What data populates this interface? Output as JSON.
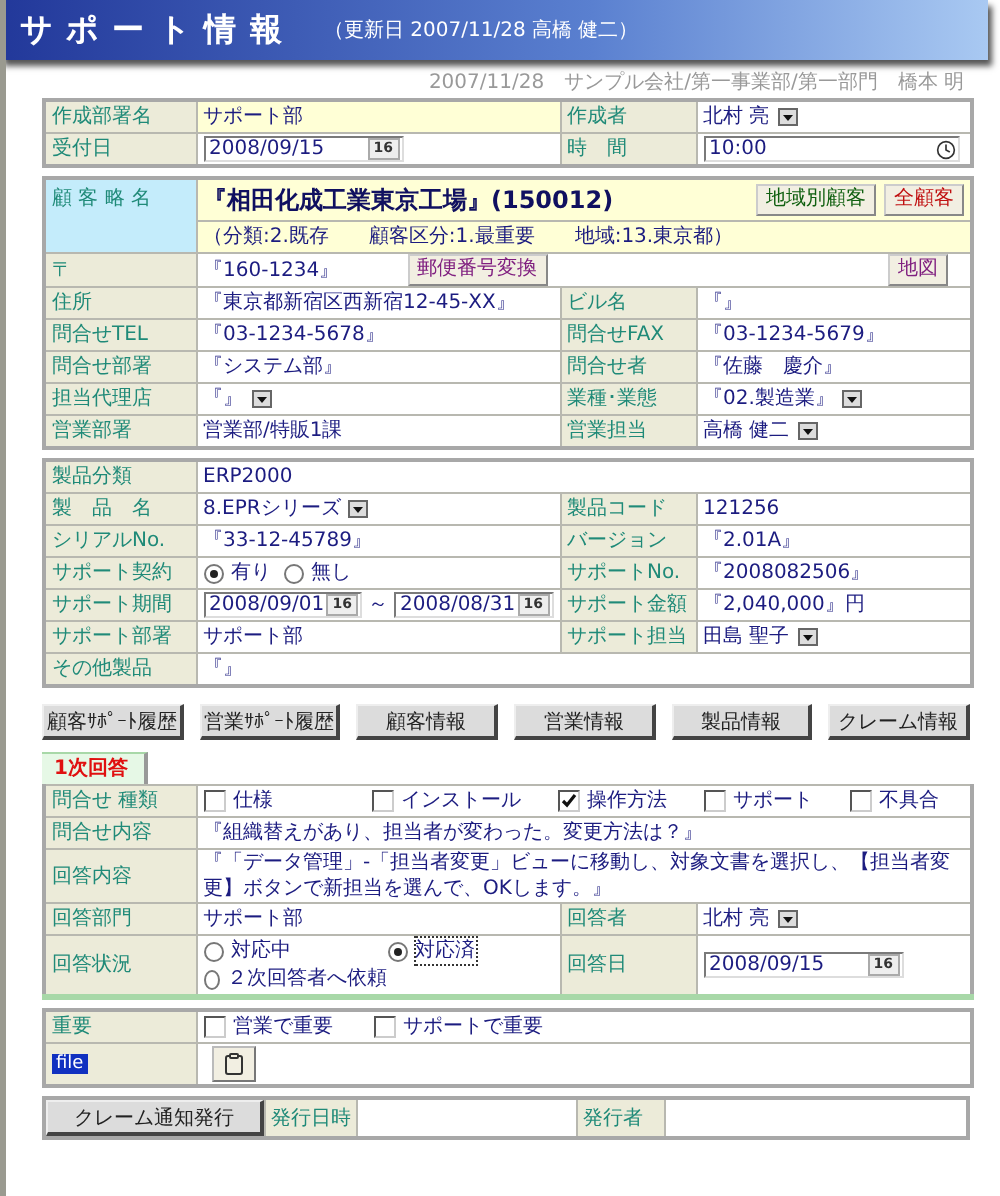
{
  "header": {
    "title": "サポート情報",
    "subtitle": "（更新日 2007/11/28 高橋 健二）"
  },
  "breadcrumb": "2007/11/28　サンプル会社/第一事業部/第一部門　橋本 明",
  "sections": [
    {
      "kind": "form",
      "rows": [
        {
          "cells": [
            {
              "kind": "label",
              "text": "作成部署名"
            },
            {
              "kind": "text",
              "text": "サポート部",
              "shaded": true
            },
            {
              "kind": "label",
              "text": "作成者"
            },
            {
              "kind": "select",
              "text": "北村 亮"
            }
          ]
        },
        {
          "cells": [
            {
              "kind": "label",
              "text": "受付日"
            },
            {
              "kind": "date",
              "value": "2008/09/15",
              "button": "16"
            },
            {
              "kind": "label",
              "text": "時　間"
            },
            {
              "kind": "time",
              "value": "10:00"
            }
          ]
        }
      ]
    },
    {
      "kind": "customer",
      "label": "顧 客 略 名",
      "name": "『相田化成工業東京工場』(150012)",
      "buttons": [
        {
          "label": "地域別顧客",
          "color": "#106010"
        },
        {
          "label": "全顧客",
          "color": "#c01010"
        }
      ],
      "details": "（分類:2.既存　　顧客区分:1.最重要　　地域:13.東京都）",
      "rows": [
        {
          "cells": [
            {
              "kind": "label",
              "text": "〒"
            },
            {
              "kind": "postal",
              "text": "『160-1234』",
              "buttons": [
                "郵便番号変換",
                "地図"
              ],
              "colspan": 3
            }
          ]
        },
        {
          "cells": [
            {
              "kind": "label",
              "text": "住所"
            },
            {
              "kind": "text",
              "text": "『東京都新宿区西新宿12-45-XX』"
            },
            {
              "kind": "label",
              "text": "ビル名"
            },
            {
              "kind": "text",
              "text": "『』"
            }
          ]
        },
        {
          "cells": [
            {
              "kind": "label",
              "text": "問合せTEL"
            },
            {
              "kind": "text",
              "text": "『03-1234-5678』"
            },
            {
              "kind": "label",
              "text": "問合せFAX"
            },
            {
              "kind": "text",
              "text": "『03-1234-5679』"
            }
          ]
        },
        {
          "cells": [
            {
              "kind": "label",
              "text": "問合せ部署"
            },
            {
              "kind": "text",
              "text": "『システム部』"
            },
            {
              "kind": "label",
              "text": "問合せ者"
            },
            {
              "kind": "text",
              "text": "『佐藤　慶介』"
            }
          ]
        },
        {
          "cells": [
            {
              "kind": "label",
              "text": "担当代理店"
            },
            {
              "kind": "select",
              "text": "『』"
            },
            {
              "kind": "label",
              "text": "業種･業態"
            },
            {
              "kind": "select",
              "text": "『02.製造業』"
            }
          ]
        },
        {
          "cells": [
            {
              "kind": "label",
              "text": "営業部署"
            },
            {
              "kind": "text",
              "text": "営業部/特販1課"
            },
            {
              "kind": "label",
              "text": "営業担当"
            },
            {
              "kind": "select",
              "text": "高橋 健二"
            }
          ]
        }
      ]
    },
    {
      "kind": "form",
      "rows": [
        {
          "cells": [
            {
              "kind": "label",
              "text": "製品分類"
            },
            {
              "kind": "text",
              "text": "ERP2000",
              "colspan": 3
            }
          ]
        },
        {
          "cells": [
            {
              "kind": "label",
              "text": "製　品　名"
            },
            {
              "kind": "select",
              "text": "8.EPRシリーズ"
            },
            {
              "kind": "label",
              "text": "製品コード"
            },
            {
              "kind": "text",
              "text": "121256"
            }
          ]
        },
        {
          "cells": [
            {
              "kind": "label",
              "text": "シリアルNo."
            },
            {
              "kind": "text",
              "text": "『33-12-45789』"
            },
            {
              "kind": "label",
              "text": "バージョン"
            },
            {
              "kind": "text",
              "text": "『2.01A』"
            }
          ]
        },
        {
          "cells": [
            {
              "kind": "label",
              "text": "サポート契約"
            },
            {
              "kind": "radios",
              "options": [
                {
                  "label": "有り",
                  "selected": true
                },
                {
                  "label": "無し",
                  "selected": false
                }
              ]
            },
            {
              "kind": "label",
              "text": "サポートNo."
            },
            {
              "kind": "text",
              "text": "『2008082506』"
            }
          ]
        },
        {
          "cells": [
            {
              "kind": "label",
              "text": "サポート期間"
            },
            {
              "kind": "range",
              "dates": [
                {
                  "value": "2008/09/01",
                  "button": "16"
                },
                {
                  "value": "2008/08/31",
                  "button": "16"
                }
              ],
              "separator": "～"
            },
            {
              "kind": "label",
              "text": "サポート金額"
            },
            {
              "kind": "text",
              "text": "『2,040,000』円"
            }
          ]
        },
        {
          "cells": [
            {
              "kind": "label",
              "text": "サポート部署"
            },
            {
              "kind": "text",
              "text": "サポート部"
            },
            {
              "kind": "label",
              "text": "サポート担当"
            },
            {
              "kind": "select",
              "text": "田島 聖子"
            }
          ]
        },
        {
          "cells": [
            {
              "kind": "label",
              "text": "その他製品"
            },
            {
              "kind": "text",
              "text": "『』",
              "colspan": 3
            }
          ]
        }
      ]
    },
    {
      "kind": "buttons",
      "items": [
        "顧客ｻﾎﾟｰﾄ履歴",
        "営業ｻﾎﾟｰﾄ履歴",
        "顧客情報",
        "営業情報",
        "製品情報",
        "クレーム情報"
      ]
    },
    {
      "kind": "tabs",
      "tabs": [
        {
          "label": "1次回答",
          "selected": true
        }
      ]
    },
    {
      "kind": "panel",
      "rows": [
        {
          "cells": [
            {
              "kind": "label",
              "text": "問合せ 種類"
            },
            {
              "kind": "checks",
              "colspan": 3,
              "options": [
                {
                  "label": "仕様",
                  "checked": false
                },
                {
                  "label": "インストール",
                  "checked": false
                },
                {
                  "label": "操作方法",
                  "checked": true
                },
                {
                  "label": "サポート",
                  "checked": false
                },
                {
                  "label": "不具合",
                  "checked": false
                }
              ]
            }
          ]
        },
        {
          "cells": [
            {
              "kind": "label",
              "text": "問合せ内容"
            },
            {
              "kind": "text",
              "text": "『組織替えがあり、担当者が変わった。変更方法は？』",
              "colspan": 3
            }
          ]
        },
        {
          "cells": [
            {
              "kind": "label",
              "text": "回答内容"
            },
            {
              "kind": "text",
              "text": "『「データ管理」-「担当者変更」ビューに移動し、対象文書を選択し、【担当者変更】ボタンで新担当を選んで、OKします。』",
              "colspan": 3
            }
          ]
        },
        {
          "cells": [
            {
              "kind": "label",
              "text": "回答部門"
            },
            {
              "kind": "text",
              "text": "サポート部"
            },
            {
              "kind": "label",
              "text": "回答者"
            },
            {
              "kind": "select",
              "text": "北村 亮"
            }
          ]
        },
        {
          "cells": [
            {
              "kind": "label",
              "text": "回答状況"
            },
            {
              "kind": "radio_grid",
              "options": [
                {
                  "label": "対応中",
                  "selected": false
                },
                {
                  "label": "対応済",
                  "selected": true
                },
                {
                  "label": "２次回答者へ依頼",
                  "selected": false
                }
              ]
            },
            {
              "kind": "label",
              "text": "回答日"
            },
            {
              "kind": "date",
              "value": "2008/09/15",
              "button": "16"
            }
          ]
        }
      ]
    },
    {
      "kind": "form",
      "rows": [
        {
          "cells": [
            {
              "kind": "label",
              "text": "重要"
            },
            {
              "kind": "checks",
              "colspan": 3,
              "options": [
                {
                  "label": "営業で重要",
                  "checked": false
                },
                {
                  "label": "サポートで重要",
                  "checked": false
                }
              ]
            }
          ]
        },
        {
          "cells": [
            {
              "kind": "tag_label",
              "text": "file"
            },
            {
              "kind": "attach",
              "colspan": 3
            }
          ]
        }
      ]
    },
    {
      "kind": "issue",
      "button": "クレーム通知発行",
      "labels": [
        "発行日時",
        "発行者"
      ]
    }
  ]
}
